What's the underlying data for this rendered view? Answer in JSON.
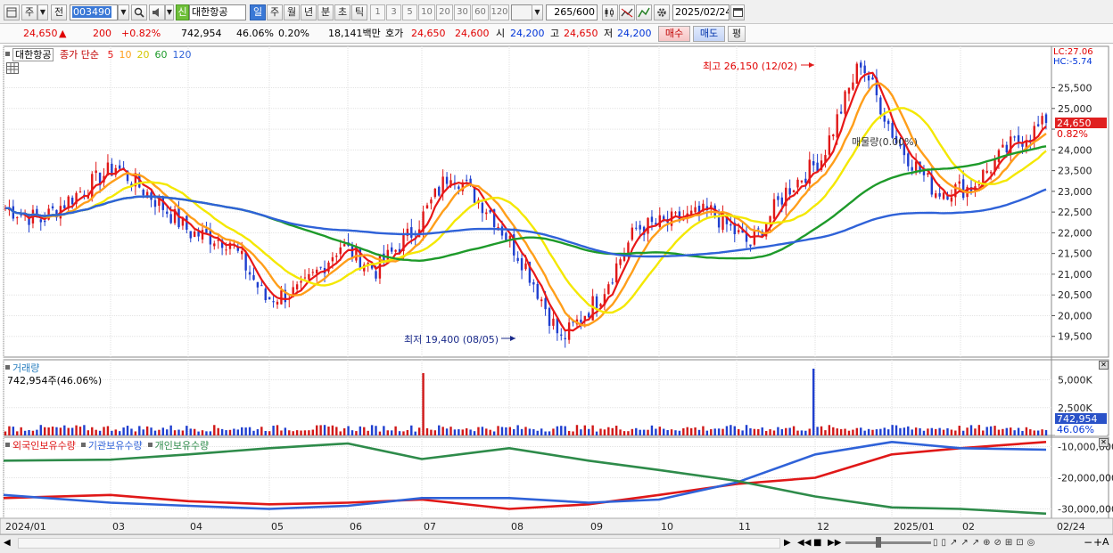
{
  "toolbar": {
    "market_label": "주",
    "prev_label": "전",
    "code_value": "003490",
    "stock_badge": "신",
    "stock_name": "대한항공",
    "periods": [
      "일",
      "주",
      "월",
      "년",
      "분",
      "초",
      "틱"
    ],
    "period_selected": "일",
    "intervals": [
      "1",
      "3",
      "5",
      "10",
      "20",
      "30",
      "60",
      "120"
    ],
    "count_value": "265",
    "count_total": "/600",
    "date_value": "2025/02/24"
  },
  "infobar": {
    "price": "24,650",
    "change_arrow": "▲",
    "change": "200",
    "change_pct": "+0.82%",
    "volume": "742,954",
    "volume_ratio": "46.06%",
    "turnover_ratio": "0.20%",
    "amount": "18,141백만",
    "quote_label": "호가",
    "ask": "24,650",
    "bid": "24,600",
    "open_label": "시",
    "open": "24,200",
    "high_label": "고",
    "high": "24,650",
    "low_label": "저",
    "low": "24,200",
    "buy_button": "매수",
    "sell_button": "매도",
    "eval_button": "평"
  },
  "price_panel": {
    "legend_name": "대한항공",
    "legend_ma": "종가 단순",
    "ma_periods": [
      "5",
      "10",
      "20",
      "60",
      "120"
    ],
    "ma_colors": [
      "#e81818",
      "#ff9e1a",
      "#f4e800",
      "#1e9a2a",
      "#2f62d8"
    ],
    "lc_label": "LC:27.06",
    "hc_label": "HC:-5.74",
    "high_annotation": "최고 26,150 (12/02)",
    "low_annotation": "최저 19,400 (08/05)",
    "mid_annotation": "매물량(0.00%)",
    "current_price_tag": "24,650",
    "current_pct_tag": "0.82%",
    "y_ticks": [
      "25,500",
      "25,000",
      "24,500",
      "24,000",
      "23,500",
      "23,000",
      "22,500",
      "22,000",
      "21,500",
      "21,000",
      "20,500",
      "20,000",
      "19,500"
    ]
  },
  "volume_panel": {
    "title": "거래량",
    "value_label": "742,954주(46.06%)",
    "y_ticks": [
      "5,000K",
      "2,500K"
    ],
    "current_tag": "742,954",
    "pct_tag": "46.06%"
  },
  "holding_panel": {
    "legend": [
      "외국인보유수량",
      "기관보유수량",
      "개인보유수량"
    ],
    "legend_colors": [
      "#e01818",
      "#2f62d8",
      "#2e8b4a"
    ],
    "y_ticks": [
      "-10,000,000",
      "-20,000,000",
      "-30,000,000"
    ]
  },
  "x_axis": {
    "labels": [
      "2024/01",
      "03",
      "04",
      "05",
      "06",
      "07",
      "08",
      "09",
      "10",
      "11",
      "12",
      "2025/01",
      "02",
      "02/24"
    ]
  },
  "chart_data": [
    {
      "type": "candlestick",
      "title": "대한항공",
      "y_range": [
        19000,
        26500
      ],
      "x_range": [
        "2024/01",
        "2025/02/24"
      ],
      "high": {
        "value": 26150,
        "date": "12/02"
      },
      "low": {
        "value": 19400,
        "date": "08/05"
      },
      "close_series": {
        "x": [
          "2024/01",
          "01/15",
          "02/01",
          "02/15",
          "03/01",
          "03/15",
          "04/01",
          "04/15",
          "05/01",
          "05/15",
          "06/01",
          "06/15",
          "07/01",
          "07/15",
          "08/01",
          "08/05",
          "08/15",
          "09/01",
          "09/15",
          "10/01",
          "10/15",
          "11/01",
          "11/15",
          "12/02",
          "12/15",
          "2025/01",
          "01/15",
          "02/01",
          "02/24"
        ],
        "values": [
          22600,
          22300,
          23000,
          23600,
          22800,
          22000,
          21800,
          20400,
          20600,
          21700,
          21100,
          22100,
          23500,
          22500,
          21200,
          19400,
          20500,
          22100,
          22300,
          22500,
          21700,
          23000,
          23800,
          26150,
          24200,
          23000,
          23100,
          24100,
          24650
        ]
      },
      "moving_averages": [
        {
          "name": "5",
          "color": "#e81818"
        },
        {
          "name": "10",
          "color": "#ff9e1a"
        },
        {
          "name": "20",
          "color": "#f4e800"
        },
        {
          "name": "60",
          "color": "#1e9a2a"
        },
        {
          "name": "120",
          "color": "#2f62d8"
        }
      ]
    },
    {
      "type": "bar",
      "title": "거래량",
      "y_range": [
        0,
        6000
      ],
      "unit": "K",
      "current": 742954,
      "spikes": [
        {
          "x": "07/01",
          "value": 5600
        },
        {
          "x": "12/02",
          "value": 6000
        }
      ]
    },
    {
      "type": "line",
      "y_range": [
        -33000000,
        -7000000
      ],
      "series": [
        {
          "name": "외국인보유수량",
          "color": "#e01818",
          "x": [
            "2024/01",
            "03",
            "04",
            "05",
            "06",
            "07",
            "08",
            "09",
            "10",
            "11",
            "12",
            "2025/01",
            "02",
            "02/24"
          ],
          "values": [
            -26500000,
            -25500000,
            -27500000,
            -28500000,
            -28000000,
            -27000000,
            -30000000,
            -28500000,
            -25500000,
            -22000000,
            -20000000,
            -12500000,
            -10500000,
            -8500000
          ]
        },
        {
          "name": "기관보유수량",
          "color": "#2f62d8",
          "x": [
            "2024/01",
            "03",
            "04",
            "05",
            "06",
            "07",
            "08",
            "09",
            "10",
            "11",
            "12",
            "2025/01",
            "02",
            "02/24"
          ],
          "values": [
            -25500000,
            -28000000,
            -29000000,
            -30000000,
            -29000000,
            -26500000,
            -26500000,
            -28000000,
            -27000000,
            -21500000,
            -12500000,
            -8500000,
            -10500000,
            -11000000
          ]
        },
        {
          "name": "개인보유수량",
          "color": "#2e8b4a",
          "x": [
            "2024/01",
            "03",
            "04",
            "05",
            "06",
            "07",
            "08",
            "09",
            "10",
            "11",
            "12",
            "2025/01",
            "02",
            "02/24"
          ],
          "values": [
            -14500000,
            -14200000,
            -12500000,
            -10500000,
            -9000000,
            -14000000,
            -10500000,
            -14500000,
            -17500000,
            -21000000,
            -26000000,
            -29500000,
            -30000000,
            -31500000
          ]
        }
      ]
    }
  ]
}
